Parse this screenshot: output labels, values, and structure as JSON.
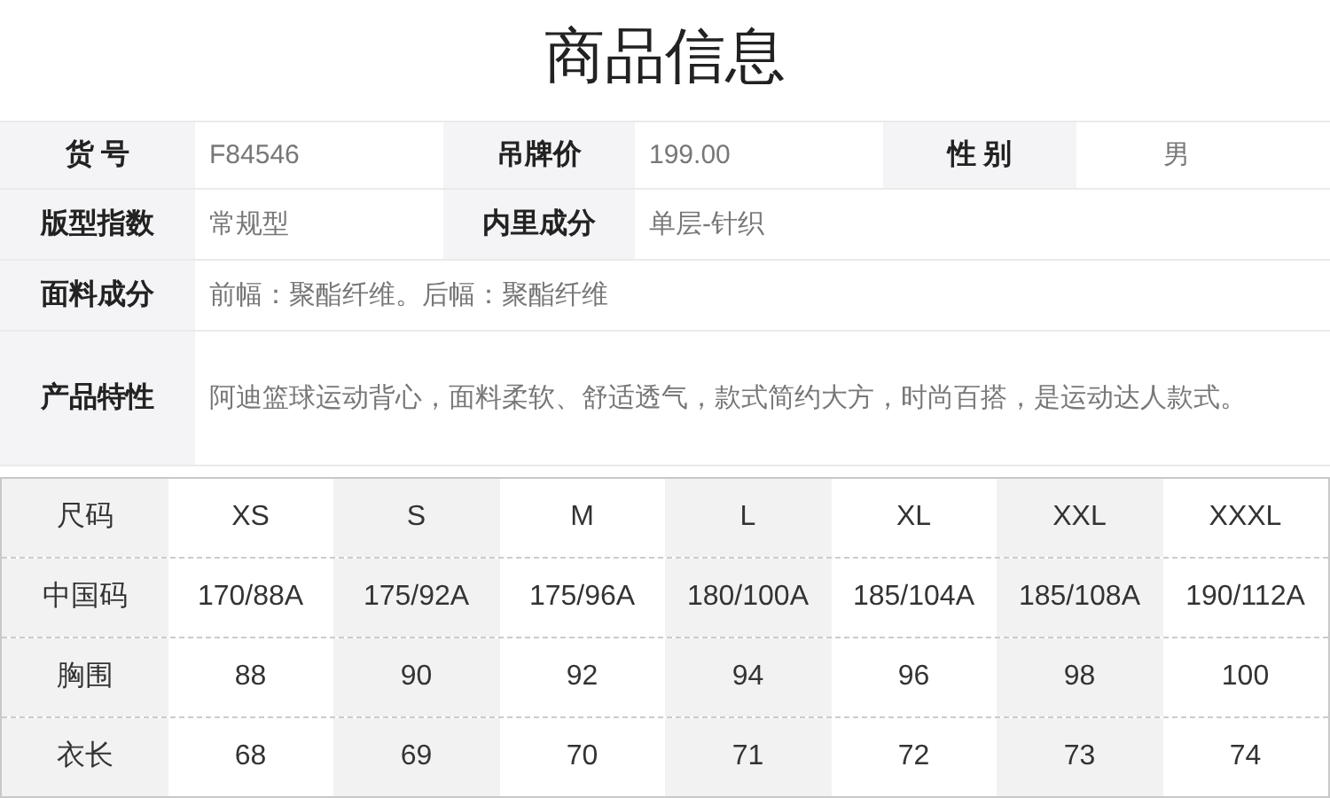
{
  "title": "商品信息",
  "info_rows": [
    {
      "pairs": [
        {
          "label": "货 号",
          "value": "F84546"
        },
        {
          "label": "吊牌价",
          "value": "199.00"
        },
        {
          "label": "性 别",
          "value": "男"
        }
      ]
    },
    {
      "pairs": [
        {
          "label": "版型指数",
          "value": "常规型"
        },
        {
          "label": "内里成分",
          "value": "单层-针织"
        }
      ]
    },
    {
      "pairs": [
        {
          "label": "面料成分",
          "value": "前幅：聚酯纤维。后幅：聚酯纤维"
        }
      ]
    },
    {
      "pairs": [
        {
          "label": "产品特性",
          "value": "阿迪篮球运动背心，面料柔软、舒适透气，款式简约大方，时尚百搭，是运动达人款式。"
        }
      ]
    }
  ],
  "size_table": {
    "columns": [
      "尺码",
      "XS",
      "S",
      "M",
      "L",
      "XL",
      "XXL",
      "XXXL"
    ],
    "rows": [
      [
        "中国码",
        "170/88A",
        "175/92A",
        "175/96A",
        "180/100A",
        "185/104A",
        "185/108A",
        "190/112A"
      ],
      [
        "胸围",
        "88",
        "90",
        "92",
        "94",
        "96",
        "98",
        "100"
      ],
      [
        "衣长",
        "68",
        "69",
        "70",
        "71",
        "72",
        "73",
        "74"
      ]
    ]
  }
}
